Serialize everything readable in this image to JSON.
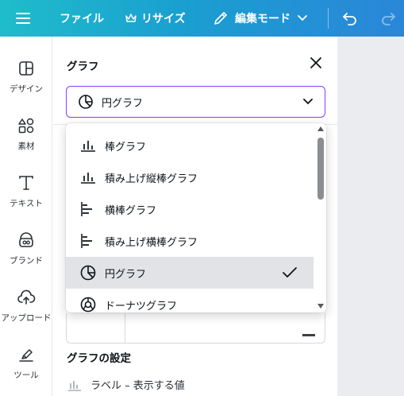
{
  "topbar": {
    "file": "ファイル",
    "resize": "リサイズ",
    "edit_mode": "編集モード"
  },
  "rail": [
    {
      "label": "デザイン",
      "icon": "design-icon"
    },
    {
      "label": "素材",
      "icon": "elements-icon"
    },
    {
      "label": "テキスト",
      "icon": "text-icon"
    },
    {
      "label": "ブランド",
      "icon": "brand-icon"
    },
    {
      "label": "アップロード",
      "icon": "upload-cloud-icon"
    },
    {
      "label": "ツール",
      "icon": "draw-tool-icon"
    }
  ],
  "panel": {
    "title": "グラフ",
    "selected_type": "円グラフ",
    "settings_title": "グラフの設定",
    "label_row": "ラベル – 表示する値"
  },
  "dropdown": {
    "items": [
      {
        "label": "棒グラフ",
        "icon": "bar-chart-icon",
        "selected": false
      },
      {
        "label": "積み上げ縦棒グラフ",
        "icon": "stacked-bar-chart-icon",
        "selected": false
      },
      {
        "label": "横棒グラフ",
        "icon": "horizontal-bar-chart-icon",
        "selected": false
      },
      {
        "label": "積み上げ横棒グラフ",
        "icon": "stacked-horizontal-bar-chart-icon",
        "selected": false
      },
      {
        "label": "円グラフ",
        "icon": "pie-chart-icon",
        "selected": true
      },
      {
        "label": "ドーナツグラフ",
        "icon": "donut-chart-icon",
        "selected": false
      }
    ]
  },
  "colors": {
    "accent": "#8b3dff",
    "topbar_start": "#1fbdcb",
    "topbar_end": "#2a86d9",
    "selected_bg": "#e1e3e6"
  }
}
